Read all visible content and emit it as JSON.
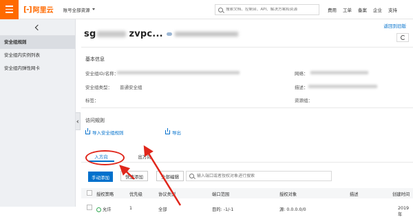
{
  "topbar": {
    "logo_text": "阿里云",
    "account_selector": "账号全部资源",
    "search_placeholder": "搜索文档、控制台、API、解决方案和资源",
    "nav": [
      "费用",
      "工单",
      "备案",
      "企业",
      "支持"
    ]
  },
  "sidebar": {
    "items": [
      {
        "label": "安全组规则",
        "active": true
      },
      {
        "label": "安全组内实例列表",
        "active": false
      },
      {
        "label": "安全组内弹性网卡",
        "active": false
      }
    ]
  },
  "header": {
    "title_prefix": "sg",
    "title": "zvpc...",
    "back_link": "返回到旧版"
  },
  "basic_info": {
    "section_title": "基本信息",
    "fields": {
      "id_name_label": "安全组ID/名称：",
      "network_label": "网络：",
      "type_label": "安全组类型：",
      "type_value": "普通安全组",
      "description_label": "描述：",
      "tags_label": "标签：",
      "resource_group_label": "资源组："
    }
  },
  "access_rules": {
    "section_title": "访问规则",
    "import_label": "导入安全组规则",
    "export_label": "导出",
    "tabs": [
      {
        "label": "入方向",
        "active": true
      },
      {
        "label": "出方向",
        "active": false
      }
    ],
    "buttons": {
      "manual_add": "手动添加",
      "quick_add": "快速添加",
      "full_edit": "全部编辑"
    },
    "filter_placeholder": "输入端口或者授权对象进行搜索",
    "columns": [
      "授权策略",
      "优先级",
      "协议类型",
      "端口范围",
      "授权对象",
      "描述",
      "创建时间"
    ],
    "rows": [
      {
        "policy": "允许",
        "priority": "1",
        "protocol": "全部",
        "port_range": "目的: -1/-1",
        "auth_object": "源: 0.0.0.0/0",
        "description": "",
        "created": "2019年"
      }
    ]
  },
  "colors": {
    "brand_orange": "#ff6a00",
    "link_blue": "#0070cc",
    "annotation_red": "#e0261b",
    "allow_green": "#32a852"
  }
}
